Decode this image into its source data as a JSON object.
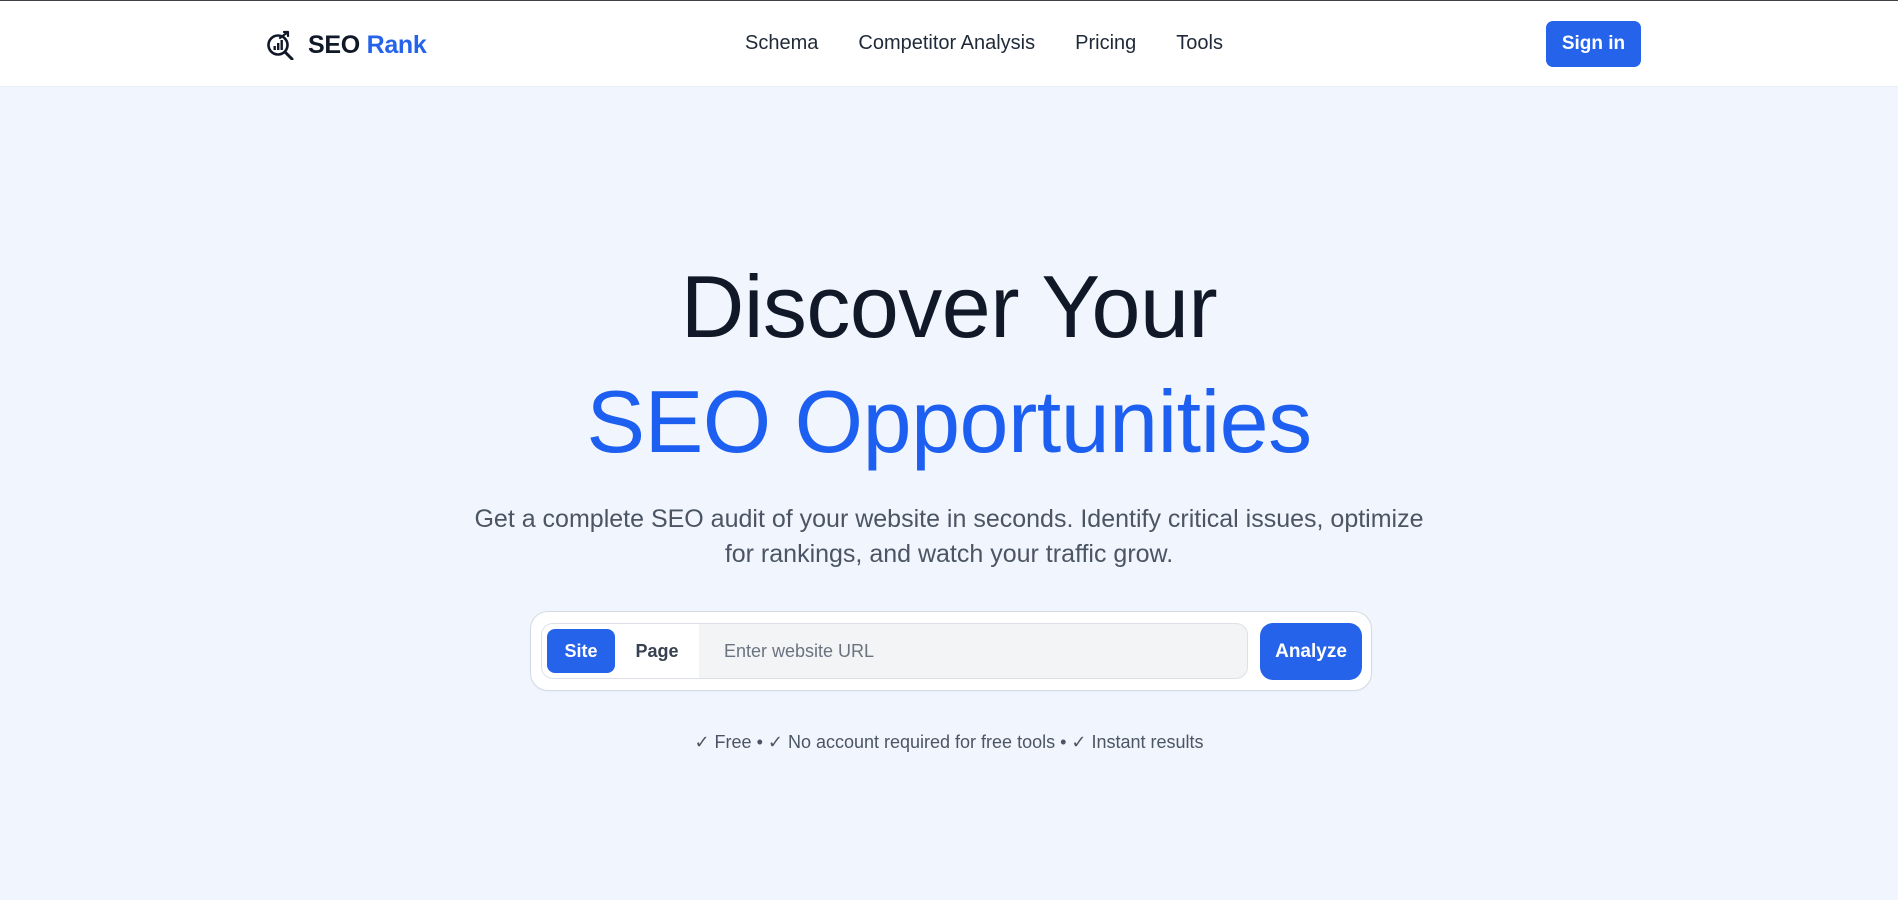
{
  "brand": {
    "name_part1": "SEO",
    "name_part2": "Rank",
    "icon": "magnifier-chart-icon"
  },
  "nav": {
    "items": [
      {
        "label": "Schema"
      },
      {
        "label": "Competitor Analysis"
      },
      {
        "label": "Pricing"
      },
      {
        "label": "Tools"
      }
    ],
    "signin_label": "Sign in"
  },
  "hero": {
    "title_line1": "Discover Your",
    "title_line2": "SEO Opportunities",
    "subtitle": "Get a complete SEO audit of your website in seconds. Identify critical issues, optimize for rankings, and watch your traffic grow."
  },
  "search": {
    "modes": [
      {
        "label": "Site",
        "selected": true
      },
      {
        "label": "Page",
        "selected": false
      }
    ],
    "url_value": "",
    "url_placeholder": "Enter website URL",
    "analyze_label": "Analyze"
  },
  "perks_text": "✓ Free • ✓ No account required for free tools • ✓ Instant results",
  "colors": {
    "accent": "#2563eb",
    "title_accent": "#1d5ff0",
    "page_background": "#f1f5fe",
    "header_background": "#ffffff",
    "heading_text": "#111827",
    "body_text": "#4b5563"
  }
}
